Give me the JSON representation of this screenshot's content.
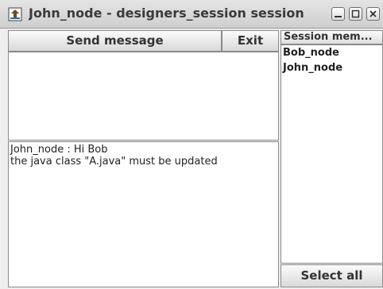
{
  "window": {
    "title": "John_node - designers_session session",
    "controls": {
      "minimize_icon": "minimize-icon",
      "maximize_icon": "maximize-icon",
      "close_icon": "close-icon"
    }
  },
  "toolbar": {
    "send_label": "Send message",
    "exit_label": "Exit"
  },
  "message_input": {
    "value": ""
  },
  "chat_log": {
    "lines": [
      "John_node : Hi Bob",
      "the java class \"A.java\" must be updated"
    ]
  },
  "members": {
    "header": "Session mem...",
    "items": [
      "Bob_node",
      "John_node"
    ],
    "select_all_label": "Select all"
  },
  "colors": {
    "background": "#eeeeee",
    "panel_white": "#ffffff",
    "border": "#8a8a8a"
  }
}
